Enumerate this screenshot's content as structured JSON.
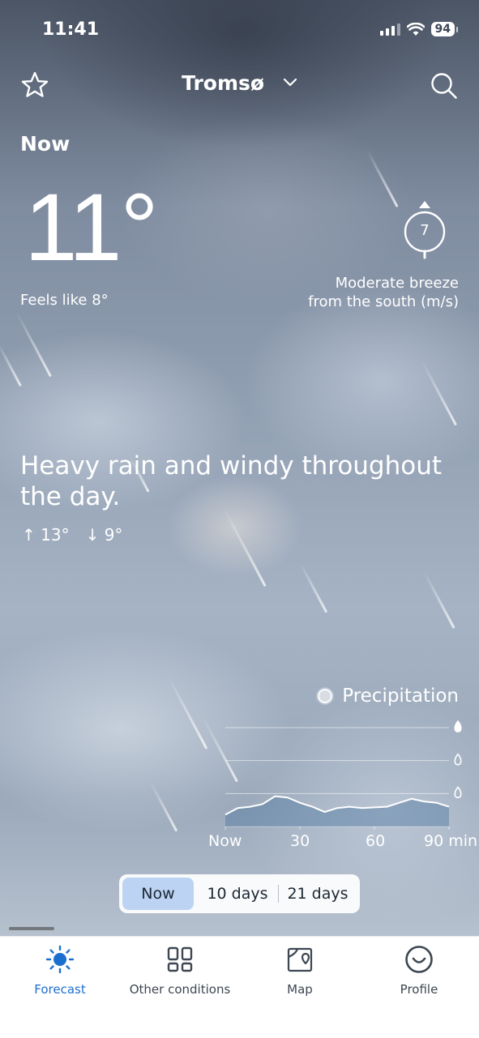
{
  "status_bar": {
    "time": "11:41",
    "battery": "94"
  },
  "header": {
    "city": "Tromsø"
  },
  "current": {
    "label": "Now",
    "temperature": "11°",
    "feels_like": "Feels like 8°",
    "wind_speed": "7",
    "wind_line1": "Moderate breeze",
    "wind_line2": "from the south (m/s)"
  },
  "summary": {
    "text": "Heavy rain and windy throughout the day.",
    "high": "13°",
    "low": "9°"
  },
  "precipitation": {
    "title": "Precipitation",
    "x_ticks": [
      "Now",
      "30",
      "60",
      "90 min"
    ]
  },
  "chart_data": {
    "type": "area",
    "title": "Precipitation",
    "x": [
      0,
      5,
      10,
      15,
      20,
      25,
      30,
      35,
      40,
      45,
      50,
      55,
      60,
      65,
      70,
      75,
      80,
      85,
      90
    ],
    "xlabel": "min",
    "series": [
      {
        "name": "Precipitation",
        "values": [
          0.18,
          0.28,
          0.3,
          0.34,
          0.46,
          0.44,
          0.36,
          0.3,
          0.22,
          0.28,
          0.3,
          0.28,
          0.29,
          0.3,
          0.36,
          0.42,
          0.38,
          0.36,
          0.3
        ]
      }
    ],
    "ylim": [
      0,
      1.5
    ],
    "grid": true
  },
  "period_toggle": {
    "options": [
      "Now",
      "10 days",
      "21 days"
    ],
    "selected": "Now"
  },
  "tabs": [
    {
      "label": "Forecast",
      "icon": "sun-icon",
      "active": true
    },
    {
      "label": "Other conditions",
      "icon": "grid-icon",
      "active": false
    },
    {
      "label": "Map",
      "icon": "map-icon",
      "active": false
    },
    {
      "label": "Profile",
      "icon": "smile-icon",
      "active": false
    }
  ],
  "colors": {
    "accent": "#1d6fcf",
    "toggle_active": "#bcd3f3"
  }
}
